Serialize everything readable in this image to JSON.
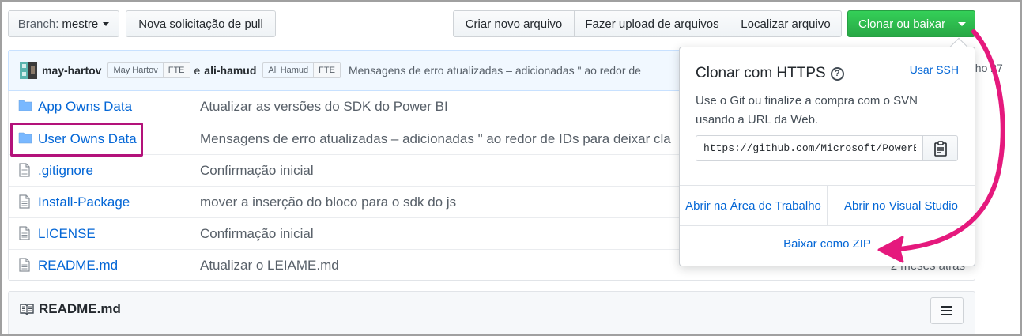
{
  "toolbar": {
    "branch_prefix": "Branch:",
    "branch_name": "mestre",
    "new_pr": "Nova solicitação de pull",
    "create_file": "Criar novo arquivo",
    "upload_files": "Fazer upload de arquivos",
    "find_file": "Localizar arquivo",
    "clone_download": "Clonar ou baixar"
  },
  "commit": {
    "author1": "may-hartov",
    "author1_name": "May Hartov",
    "author1_tag": "FTE",
    "connector": "e",
    "author2": "ali-hamud",
    "author2_name": "Ali Hamud",
    "author2_tag": "FTE",
    "message": "Mensagens de erro atualizadas – adicionadas \" ao redor de",
    "date_fragment": "nho 27"
  },
  "files": [
    {
      "name": "App Owns Data",
      "type": "folder",
      "message": "Atualizar as versões do SDK do Power BI",
      "age": ""
    },
    {
      "name": "User Owns Data",
      "type": "folder",
      "message": "Mensagens de erro atualizadas – adicionadas \" ao redor de IDs para deixar cla",
      "age": ""
    },
    {
      "name": ".gitignore",
      "type": "file",
      "message": "Confirmação inicial",
      "age": ""
    },
    {
      "name": "Install-Package",
      "type": "file",
      "message": "mover a inserção do bloco para o sdk do js",
      "age": ""
    },
    {
      "name": "LICENSE",
      "type": "file",
      "message": "Confirmação inicial",
      "age": ""
    },
    {
      "name": "README.md",
      "type": "file",
      "message": "Atualizar o LEIAME.md",
      "age": "2 meses atrás"
    }
  ],
  "readme": {
    "title": "README.md"
  },
  "clone_popover": {
    "title": "Clonar com HTTPS",
    "use_ssh": "Usar SSH",
    "description": "Use o Git ou finalize a compra com o SVN usando a URL da Web.",
    "url": "https://github.com/Microsoft/PowerBI-Developer-Samples.git",
    "open_desktop": "Abrir na Área de Trabalho",
    "open_vs": "Abrir no Visual Studio",
    "download_zip": "Baixar como ZIP"
  },
  "colors": {
    "green_button": "#2ea44f",
    "link": "#0366d6",
    "highlight": "#b3127a",
    "arrow": "#e5197d"
  }
}
